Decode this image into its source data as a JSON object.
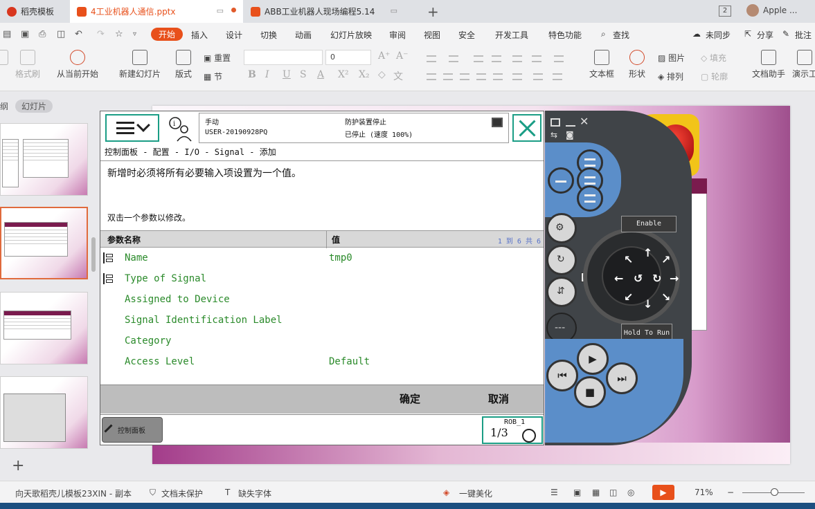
{
  "tabs": [
    {
      "label": "稻壳模板"
    },
    {
      "label": "4工业机器人通信.pptx"
    },
    {
      "label": "ABB工业机器人现场编程5.14"
    }
  ],
  "window_count": "2",
  "user_name": "Apple ...",
  "menu": [
    "开始",
    "插入",
    "设计",
    "切换",
    "动画",
    "幻灯片放映",
    "审阅",
    "视图",
    "安全",
    "开发工具",
    "特色功能",
    "查找"
  ],
  "menu_right": {
    "sync": "未同步",
    "share": "分享",
    "annotate": "批注"
  },
  "ribbon": {
    "format_painter": "格式刷",
    "from_current": "从当前开始",
    "new_slide": "新建幻灯片",
    "layout": "版式",
    "reset": "重置",
    "section": "节",
    "font_size": "0",
    "textbox": "文本框",
    "shape": "形状",
    "picture": "图片",
    "arrange": "排列",
    "fill": "填充",
    "outline": "轮廓",
    "doc_helper": "文档助手",
    "presenter": "演示工"
  },
  "left_panel": {
    "tab_outline": "纲",
    "tab_slides": "幻灯片"
  },
  "flexpendant": {
    "status": {
      "mode": "手动",
      "system": "USER-20190928PQ",
      "state": "防护装置停止",
      "speed": "已停止 (速度 100%)"
    },
    "breadcrumb": "控制面板 - 配置 - I/O - Signal - 添加",
    "message1": "新增时必须将所有必要输入项设置为一个值。",
    "message2": "双击一个参数以修改。",
    "table": {
      "col_name": "参数名称",
      "col_value": "值",
      "range": "1 到 6 共 6",
      "rows": [
        {
          "name": "Name",
          "value": "tmp0",
          "required": true
        },
        {
          "name": "Type of Signal",
          "value": "",
          "required": true
        },
        {
          "name": "Assigned to Device",
          "value": "",
          "required": false
        },
        {
          "name": "Signal Identification Label",
          "value": "",
          "required": false
        },
        {
          "name": "Category",
          "value": "",
          "required": false
        },
        {
          "name": "Access Level",
          "value": "Default",
          "required": false
        }
      ]
    },
    "ok": "确定",
    "cancel": "取消",
    "control_panel": "控制面板",
    "robot": "ROB_1",
    "fraction": "1/3"
  },
  "pendant_hw": {
    "enable": "Enable",
    "hold_to_run": "Hold To Run"
  },
  "statusbar": {
    "template": "向天歌稻壳儿模板23XIN - 副本",
    "protect": "文档未保护",
    "missing_font": "缺失字体",
    "beautify": "一键美化",
    "zoom": "71%"
  }
}
